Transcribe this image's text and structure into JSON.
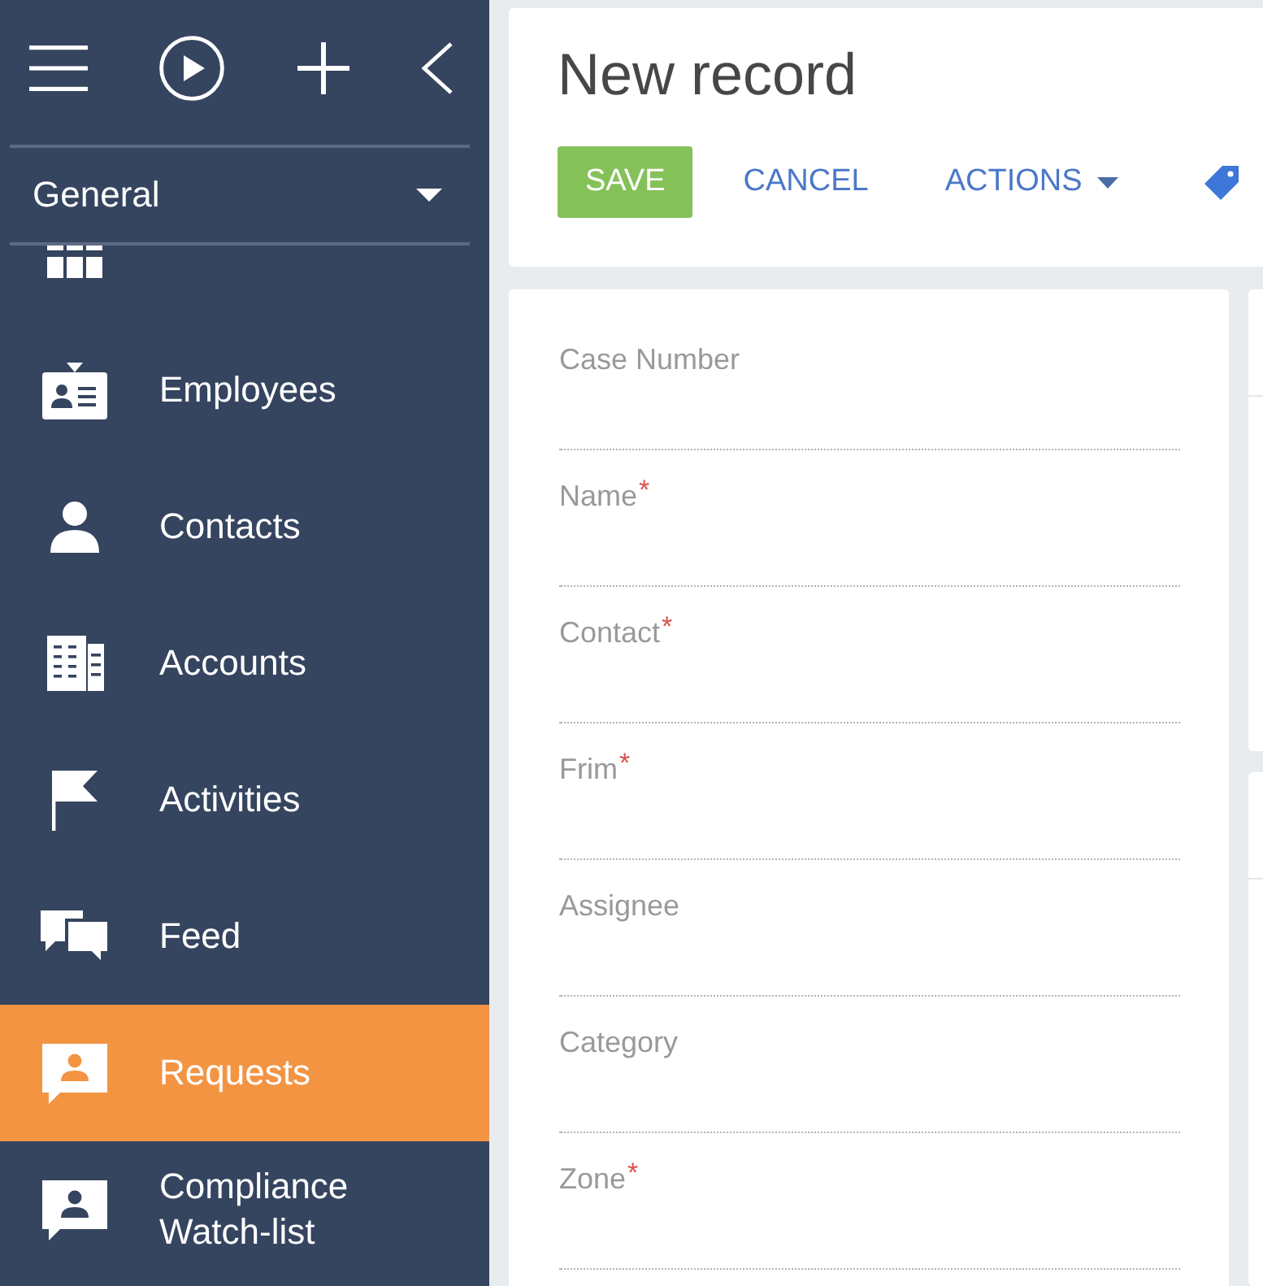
{
  "sidebar": {
    "workplace": {
      "value": "General"
    },
    "items": [
      {
        "selected": false
      },
      {
        "label": "Employees",
        "selected": false
      },
      {
        "label": "Contacts",
        "selected": false
      },
      {
        "label": "Accounts",
        "selected": false
      },
      {
        "label": "Activities",
        "selected": false
      },
      {
        "label": "Feed",
        "selected": false
      },
      {
        "label": "Requests",
        "selected": true
      },
      {
        "label": "Compliance Watch-list",
        "selected": false
      }
    ]
  },
  "header": {
    "title": "New record",
    "actions": [
      {
        "label": "SAVE",
        "kind": "primary"
      },
      {
        "label": "CANCEL",
        "kind": "link"
      },
      {
        "label": "ACTIONS",
        "kind": "menu"
      }
    ]
  },
  "form": {
    "fields": [
      {
        "label": "Case Number"
      },
      {
        "label": "Name$^{*}$"
      },
      {
        "label": "Contact$^{*}$"
      },
      {
        "label": "Frim$^{*}$"
      },
      {
        "label": "Assignee"
      },
      {
        "label": "Category"
      },
      {
        "label": "Zone$^{*}$"
      }
    ]
  }
}
